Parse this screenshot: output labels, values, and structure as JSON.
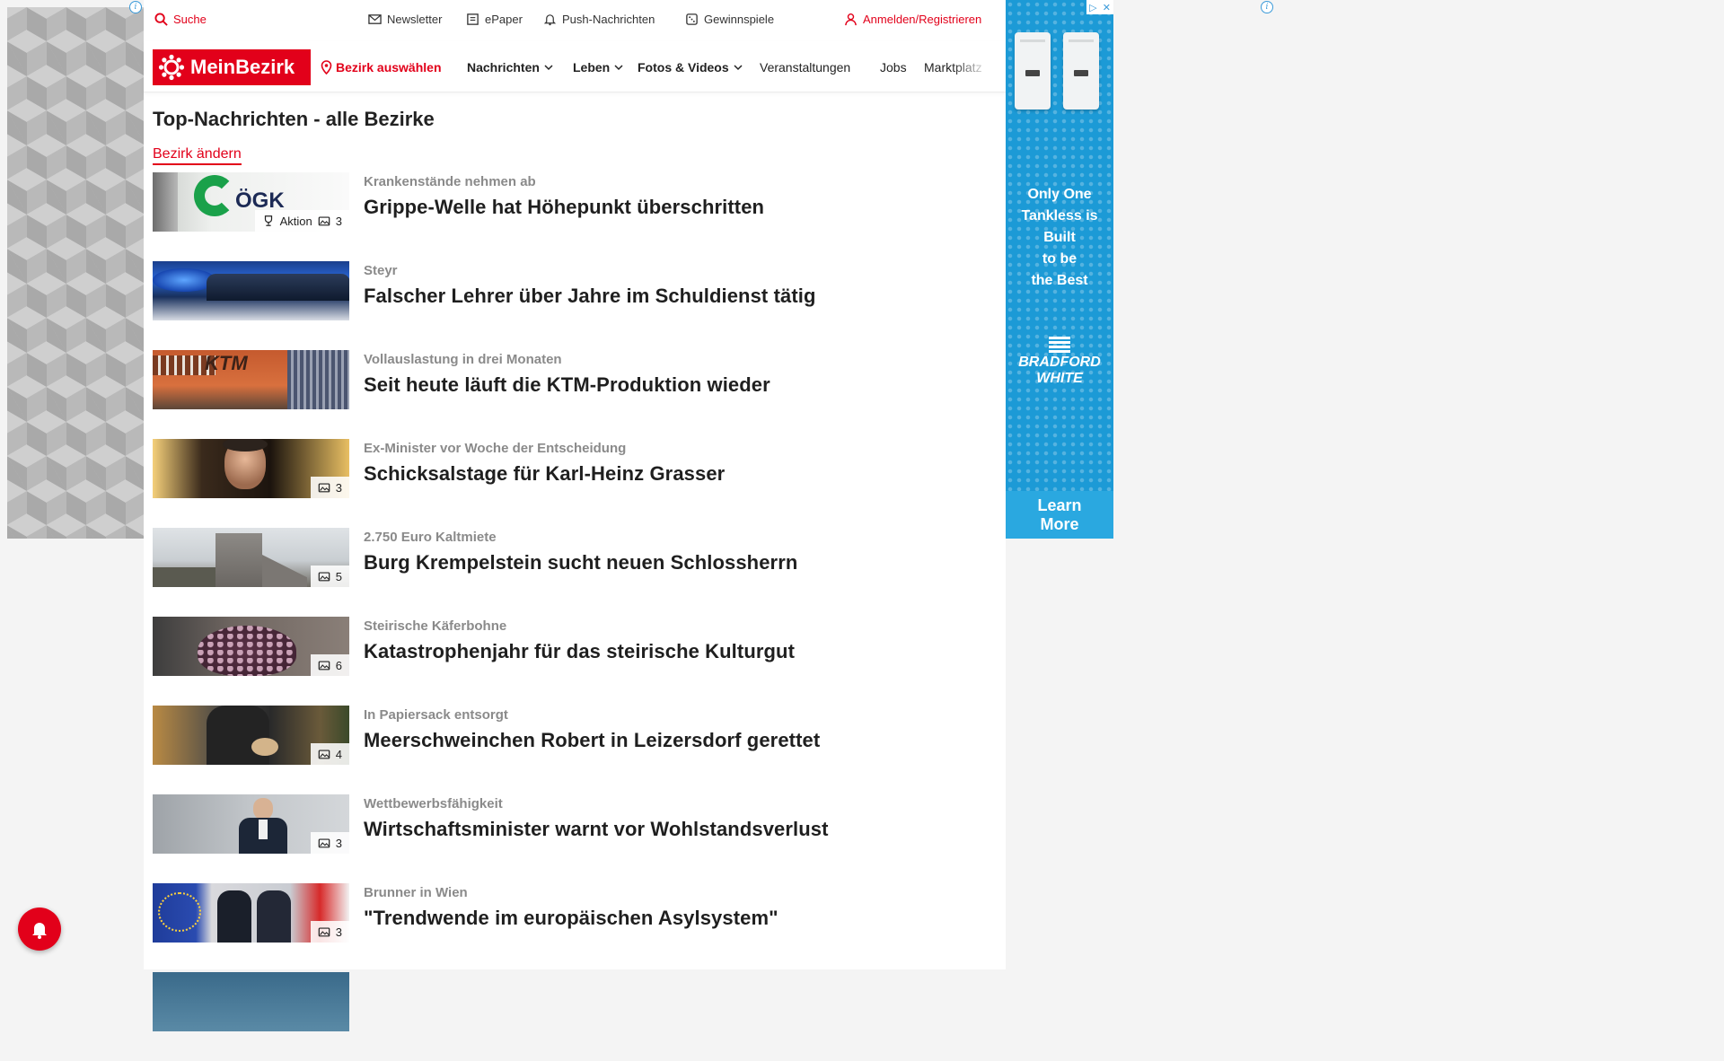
{
  "topbar": {
    "search": "Suche",
    "newsletter": "Newsletter",
    "epaper": "ePaper",
    "push": "Push-Nachrichten",
    "games": "Gewinnspiele",
    "login": "Anmelden/Registrieren"
  },
  "nav": {
    "logo": "MeinBezirk",
    "district": "Bezirk auswählen",
    "news": "Nachrichten",
    "life": "Leben",
    "photos": "Fotos & Videos",
    "events": "Veranstaltungen",
    "jobs": "Jobs",
    "market": "Marktplatz"
  },
  "page": {
    "title": "Top-Nachrichten - alle Bezirke",
    "change_district": "Bezirk ändern"
  },
  "articles": [
    {
      "kicker": "Krankenstände nehmen ab",
      "headline": "Grippe-Welle hat Höhepunkt überschritten",
      "badge_label": "Aktion",
      "photos": "3"
    },
    {
      "kicker": "Steyr",
      "headline": "Falscher Lehrer über Jahre im Schuldienst tätig"
    },
    {
      "kicker": "Vollauslastung in drei Monaten",
      "headline": "Seit heute läuft die KTM-Produktion wieder"
    },
    {
      "kicker": "Ex-Minister vor Woche der Entscheidung",
      "headline": "Schicksalstage für Karl-Heinz Grasser",
      "photos": "3"
    },
    {
      "kicker": "2.750 Euro Kaltmiete",
      "headline": "Burg Krempelstein sucht neuen Schlossherrn",
      "photos": "5"
    },
    {
      "kicker": "Steirische Käferbohne",
      "headline": "Katastrophenjahr für das steirische Kulturgut",
      "photos": "6"
    },
    {
      "kicker": "In Papiersack entsorgt",
      "headline": "Meerschweinchen Robert in Leizersdorf gerettet",
      "photos": "4"
    },
    {
      "kicker": "Wettbewerbsfähigkeit",
      "headline": "Wirtschaftsminister warnt vor Wohlstandsverlust",
      "photos": "3"
    },
    {
      "kicker": "Brunner in Wien",
      "headline": "\"Trendwende im europäischen Asylsystem\"",
      "photos": "3"
    }
  ],
  "ad": {
    "tagline_1": "Only One",
    "tagline_2": "Tankless is",
    "tagline_3": "Built",
    "tagline_4": "to be",
    "tagline_5": "the Best",
    "brand_1": "BRADFORD",
    "brand_2": "WHITE",
    "cta_1": "Learn",
    "cta_2": "More"
  },
  "colors": {
    "brand_red": "#e2001a",
    "ad_blue": "#1c9ad6"
  },
  "icons": [
    "search-icon",
    "mail-icon",
    "newspaper-icon",
    "bell-icon",
    "gift-icon",
    "user-icon",
    "location-pin-icon",
    "chevron-down-icon",
    "camera-icon",
    "trophy-icon"
  ]
}
